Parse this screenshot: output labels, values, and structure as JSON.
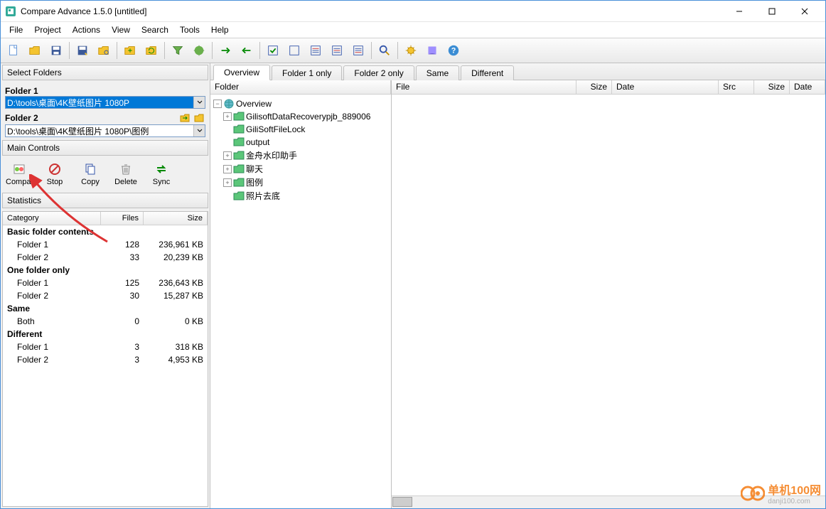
{
  "window": {
    "title": "Compare Advance 1.5.0 [untitled]"
  },
  "menu": [
    "File",
    "Project",
    "Actions",
    "View",
    "Search",
    "Tools",
    "Help"
  ],
  "selectFolders": {
    "header": "Select Folders",
    "folder1_label": "Folder 1",
    "folder1_value": "D:\\tools\\桌面\\4K壁纸图片 1080P",
    "folder2_label": "Folder 2",
    "folder2_value": "D:\\tools\\桌面\\4K壁纸图片 1080P\\图例"
  },
  "mainControls": {
    "header": "Main Controls",
    "compare": "Compare",
    "stop": "Stop",
    "copy": "Copy",
    "delete": "Delete",
    "sync": "Sync"
  },
  "statistics": {
    "header": "Statistics",
    "cols": {
      "category": "Category",
      "files": "Files",
      "size": "Size"
    },
    "groups": [
      {
        "title": "Basic folder contents",
        "rows": [
          {
            "label": "Folder 1",
            "files": "128",
            "size": "236,961 KB"
          },
          {
            "label": "Folder 2",
            "files": "33",
            "size": "20,239 KB"
          }
        ]
      },
      {
        "title": "One folder only",
        "rows": [
          {
            "label": "Folder 1",
            "files": "125",
            "size": "236,643 KB"
          },
          {
            "label": "Folder 2",
            "files": "30",
            "size": "15,287 KB"
          }
        ]
      },
      {
        "title": "Same",
        "rows": [
          {
            "label": "Both",
            "files": "0",
            "size": "0 KB"
          }
        ]
      },
      {
        "title": "Different",
        "rows": [
          {
            "label": "Folder 1",
            "files": "3",
            "size": "318 KB"
          },
          {
            "label": "Folder 2",
            "files": "3",
            "size": "4,953 KB"
          }
        ]
      }
    ]
  },
  "tabs": [
    "Overview",
    "Folder 1 only",
    "Folder 2 only",
    "Same",
    "Different"
  ],
  "treeHeader": "Folder",
  "tree": {
    "root": "Overview",
    "children": [
      "GilisoftDataRecoverypjb_889006",
      "GiliSoftFileLock",
      "output",
      "金舟水印助手",
      "聊天",
      "图例",
      "照片去底"
    ]
  },
  "fileCols": {
    "file": "File",
    "size": "Size",
    "date": "Date",
    "src": "Src",
    "size2": "Size",
    "date2": "Date"
  },
  "watermark": {
    "line1": "单机100网",
    "line2": "danji100.com"
  }
}
